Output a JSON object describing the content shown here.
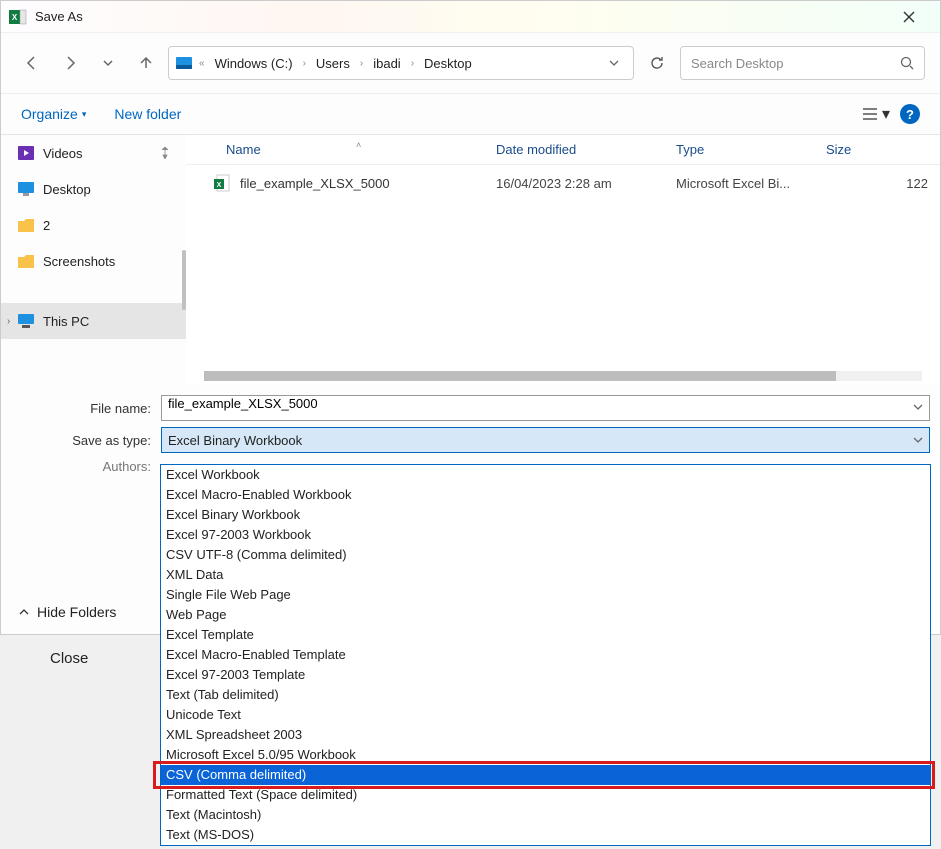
{
  "title": "Save As",
  "breadcrumbs": [
    "Windows (C:)",
    "Users",
    "ibadi",
    "Desktop"
  ],
  "search_placeholder": "Search Desktop",
  "toolbar": {
    "organize": "Organize",
    "new_folder": "New folder"
  },
  "sidebar": {
    "items": [
      {
        "label": "Videos",
        "pinned": true
      },
      {
        "label": "Desktop"
      },
      {
        "label": "2"
      },
      {
        "label": "Screenshots"
      }
    ],
    "thispc": "This PC"
  },
  "columns": {
    "name": "Name",
    "date": "Date modified",
    "type": "Type",
    "size": "Size"
  },
  "files": [
    {
      "name": "file_example_XLSX_5000",
      "date": "16/04/2023 2:28 am",
      "type": "Microsoft Excel Bi...",
      "size": "122"
    }
  ],
  "form": {
    "file_name_label": "File name:",
    "file_name_value": "file_example_XLSX_5000",
    "save_type_label": "Save as type:",
    "save_type_value": "Excel Binary Workbook",
    "authors_label": "Authors:"
  },
  "hide_folders": "Hide Folders",
  "close": "Close",
  "dropdown_items": [
    "Excel Workbook",
    "Excel Macro-Enabled Workbook",
    "Excel Binary Workbook",
    "Excel 97-2003 Workbook",
    "CSV UTF-8 (Comma delimited)",
    "XML Data",
    "Single File Web Page",
    "Web Page",
    "Excel Template",
    "Excel Macro-Enabled Template",
    "Excel 97-2003 Template",
    "Text (Tab delimited)",
    "Unicode Text",
    "XML Spreadsheet 2003",
    "Microsoft Excel 5.0/95 Workbook",
    "CSV (Comma delimited)",
    "Formatted Text (Space delimited)",
    "Text (Macintosh)",
    "Text (MS-DOS)"
  ],
  "dropdown_selected_index": 15
}
